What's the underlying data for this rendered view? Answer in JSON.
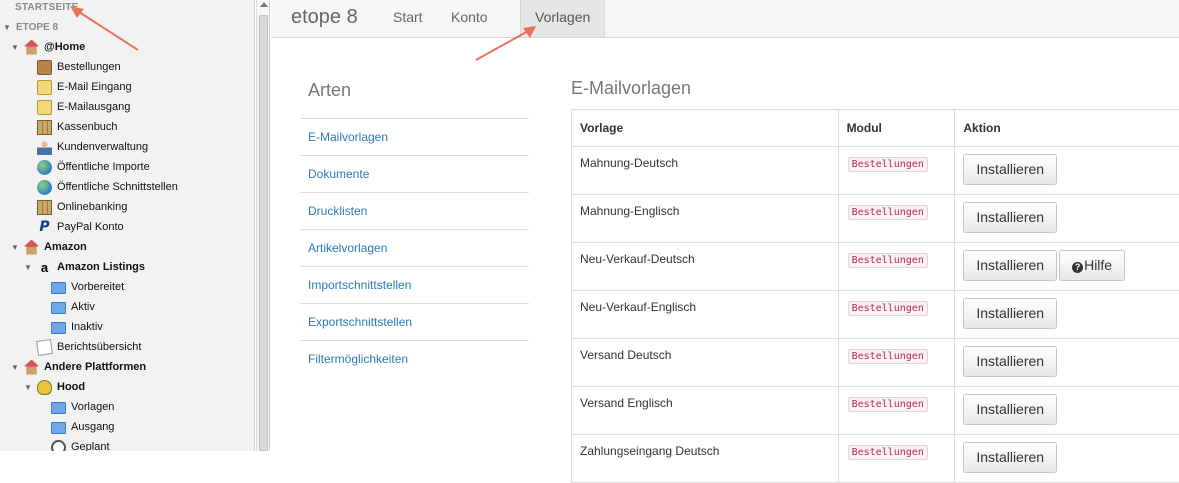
{
  "sidebar": {
    "start": "STARTSEITE",
    "section": "ETOPE 8",
    "tree": [
      {
        "label": "@Home",
        "icon": "house-icon",
        "level": 1,
        "group": true
      },
      {
        "label": "Bestellungen",
        "icon": "shopping-bag-icon",
        "level": 2
      },
      {
        "label": "E-Mail Eingang",
        "icon": "mail-inbox-icon",
        "level": 2
      },
      {
        "label": "E-Mailausgang",
        "icon": "mail-outbox-icon",
        "level": 2
      },
      {
        "label": "Kassenbuch",
        "icon": "cashbook-icon",
        "level": 2
      },
      {
        "label": "Kundenverwaltung",
        "icon": "customer-icon",
        "level": 2
      },
      {
        "label": "Öffentliche Importe",
        "icon": "globe-icon",
        "level": 2
      },
      {
        "label": "Öffentliche Schnittstellen",
        "icon": "globe-icon",
        "level": 2
      },
      {
        "label": "Onlinebanking",
        "icon": "bank-icon",
        "level": 2
      },
      {
        "label": "PayPal Konto",
        "icon": "paypal-icon",
        "level": 2
      },
      {
        "label": "Amazon",
        "icon": "house-icon",
        "level": 1,
        "group": true
      },
      {
        "label": "Amazon Listings",
        "icon": "amazon-icon",
        "level": 2,
        "group": true
      },
      {
        "label": "Vorbereitet",
        "icon": "folder-icon",
        "level": 3
      },
      {
        "label": "Aktiv",
        "icon": "folder-icon",
        "level": 3
      },
      {
        "label": "Inaktiv",
        "icon": "folder-icon",
        "level": 3
      },
      {
        "label": "Berichtsübersicht",
        "icon": "report-icon",
        "level": 2
      },
      {
        "label": "Andere Plattformen",
        "icon": "house-icon",
        "level": 1,
        "group": true
      },
      {
        "label": "Hood",
        "icon": "hood-icon",
        "level": 2,
        "group": true
      },
      {
        "label": "Vorlagen",
        "icon": "folder-icon",
        "level": 3
      },
      {
        "label": "Ausgang",
        "icon": "folder-icon",
        "level": 3
      },
      {
        "label": "Geplant",
        "icon": "clock-icon",
        "level": 3
      }
    ]
  },
  "topbar": {
    "brand": "etope 8",
    "nav": [
      "Start",
      "Konto",
      "Vorlagen"
    ],
    "active": "Vorlagen"
  },
  "arten": {
    "title": "Arten",
    "items": [
      "E-Mailvorlagen",
      "Dokumente",
      "Drucklisten",
      "Artikelvorlagen",
      "Importschnittstellen",
      "Exportschnittstellen",
      "Filtermöglichkeiten"
    ]
  },
  "panel": {
    "title": "E-Mailvorlagen",
    "headers": [
      "Vorlage",
      "Modul",
      "Aktion"
    ],
    "install_label": "Installieren",
    "help_label": "Hilfe",
    "rows": [
      {
        "name": "Mahnung-Deutsch",
        "modul": "Bestellungen",
        "help": false
      },
      {
        "name": "Mahnung-Englisch",
        "modul": "Bestellungen",
        "help": false
      },
      {
        "name": "Neu-Verkauf-Deutsch",
        "modul": "Bestellungen",
        "help": true
      },
      {
        "name": "Neu-Verkauf-Englisch",
        "modul": "Bestellungen",
        "help": false
      },
      {
        "name": "Versand Deutsch",
        "modul": "Bestellungen",
        "help": false
      },
      {
        "name": "Versand Englisch",
        "modul": "Bestellungen",
        "help": false
      },
      {
        "name": "Zahlungseingang Deutsch",
        "modul": "Bestellungen",
        "help": false
      }
    ]
  },
  "colors": {
    "link": "#2a7ab6",
    "badge": "#c7254e",
    "arrow": "#e8735a"
  }
}
